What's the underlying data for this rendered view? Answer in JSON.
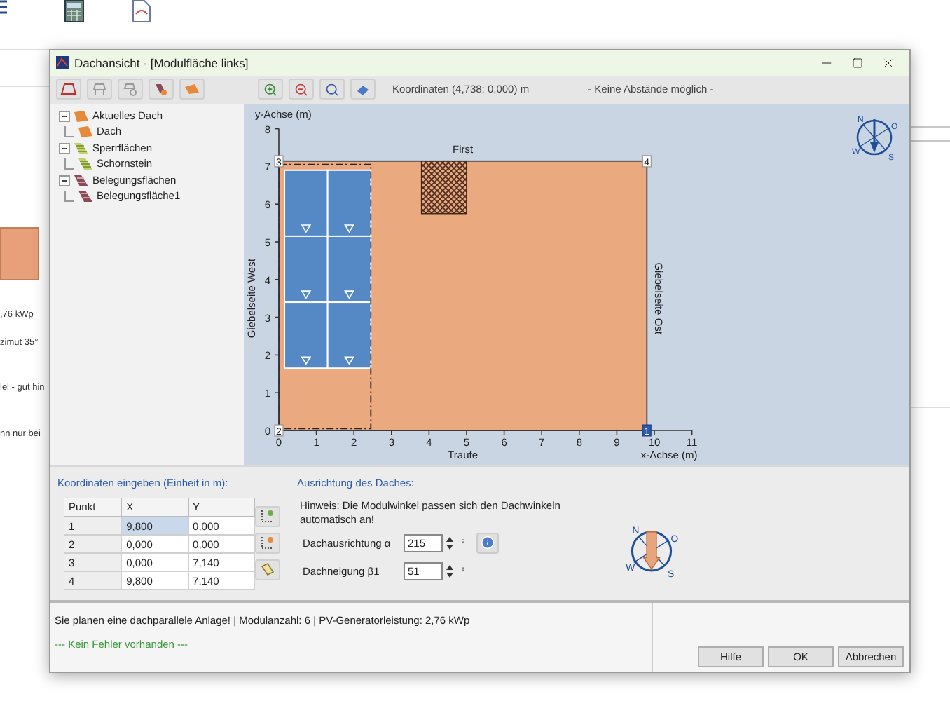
{
  "background_app": {
    "texts": [
      ",76 kWp",
      "zimut 35°",
      "lel - gut hin",
      "nn nur bei"
    ]
  },
  "window": {
    "title": "Dachansicht - [Modulfläche links]"
  },
  "toolbar": {
    "coordinates": "Koordinaten (4,738; 0,000) m",
    "spacing_note": "- Keine Abstände möglich -"
  },
  "tree": [
    {
      "label": "Aktuelles Dach",
      "kind": "roof",
      "expanded": true,
      "children": [
        {
          "label": "Dach",
          "kind": "roof"
        }
      ]
    },
    {
      "label": "Sperrflächen",
      "kind": "blocked",
      "expanded": true,
      "children": [
        {
          "label": "Schornstein",
          "kind": "blocked"
        }
      ]
    },
    {
      "label": "Belegungsflächen",
      "kind": "modules",
      "expanded": true,
      "children": [
        {
          "label": "Belegungsfläche1",
          "kind": "modules"
        }
      ]
    }
  ],
  "plot": {
    "y_axis_label": "y-Achse (m)",
    "x_axis_label": "x-Achse (m)",
    "y_ticks": [
      "8",
      "7",
      "6",
      "5",
      "4",
      "3",
      "2",
      "1",
      "0"
    ],
    "x_ticks": [
      "0",
      "1",
      "2",
      "3",
      "4",
      "5",
      "6",
      "7",
      "8",
      "9",
      "10",
      "11"
    ],
    "top_label": "First",
    "bottom_label": "Traufe",
    "left_label": "Giebelseite West",
    "right_label": "Giebelseite Ost",
    "corners": [
      {
        "label": "3",
        "selected": false
      },
      {
        "label": "2",
        "selected": false
      },
      {
        "label": "4",
        "selected": false
      },
      {
        "label": "1",
        "selected": true
      }
    ],
    "compass": {
      "n": "N",
      "o": "O",
      "w": "W",
      "s": "S"
    }
  },
  "coordinates": {
    "title": "Koordinaten eingeben (Einheit in m):",
    "columns": [
      "Punkt",
      "X",
      "Y"
    ],
    "rows": [
      {
        "cells": [
          "1",
          "9,800",
          "0,000"
        ],
        "selected": true
      },
      {
        "cells": [
          "2",
          "0,000",
          "0,000"
        ],
        "selected": false
      },
      {
        "cells": [
          "3",
          "0,000",
          "7,140"
        ],
        "selected": false
      },
      {
        "cells": [
          "4",
          "9,800",
          "7,140"
        ],
        "selected": false
      }
    ]
  },
  "orientation": {
    "title": "Ausrichtung des Daches:",
    "hint": "Hinweis: Die Modulwinkel passen sich den Dachwinkeln automatisch an!",
    "fields": [
      {
        "label": "Dachausrichtung α",
        "value": "215",
        "unit": "°",
        "info": true
      },
      {
        "label": "Dachneigung β1",
        "value": "51",
        "unit": "°"
      }
    ],
    "compass": {
      "n": "N",
      "o": "O",
      "w": "W",
      "s": "S"
    }
  },
  "status": {
    "message": "Sie planen eine dachparallele Anlage! | Modulanzahl: 6 | PV-Generatorleistung: 2,76 kWp",
    "check": "--- Kein Fehler vorhanden ---"
  },
  "buttons": [
    "Hilfe",
    "OK",
    "Abbrechen"
  ]
}
